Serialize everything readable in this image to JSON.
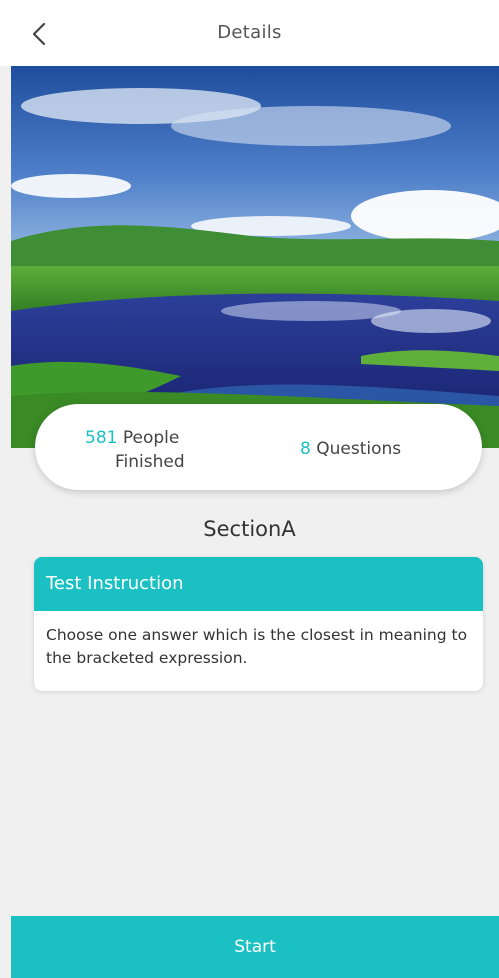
{
  "header": {
    "back_icon": "chevron-left-icon",
    "title": "Details"
  },
  "hero": {
    "description": "landscape-image"
  },
  "stats": {
    "people_count": "581",
    "people_label_1": "People",
    "people_label_2": "Finished",
    "questions_count": "8",
    "questions_label": "Questions"
  },
  "section": {
    "title": "SectionA"
  },
  "instruction": {
    "heading": "Test Instruction",
    "body": "Choose one answer which is the closest in meaning to the bracketed expression."
  },
  "footer": {
    "start_label": "Start"
  },
  "colors": {
    "accent": "#1bc1c2",
    "background": "#f0f0f0"
  }
}
